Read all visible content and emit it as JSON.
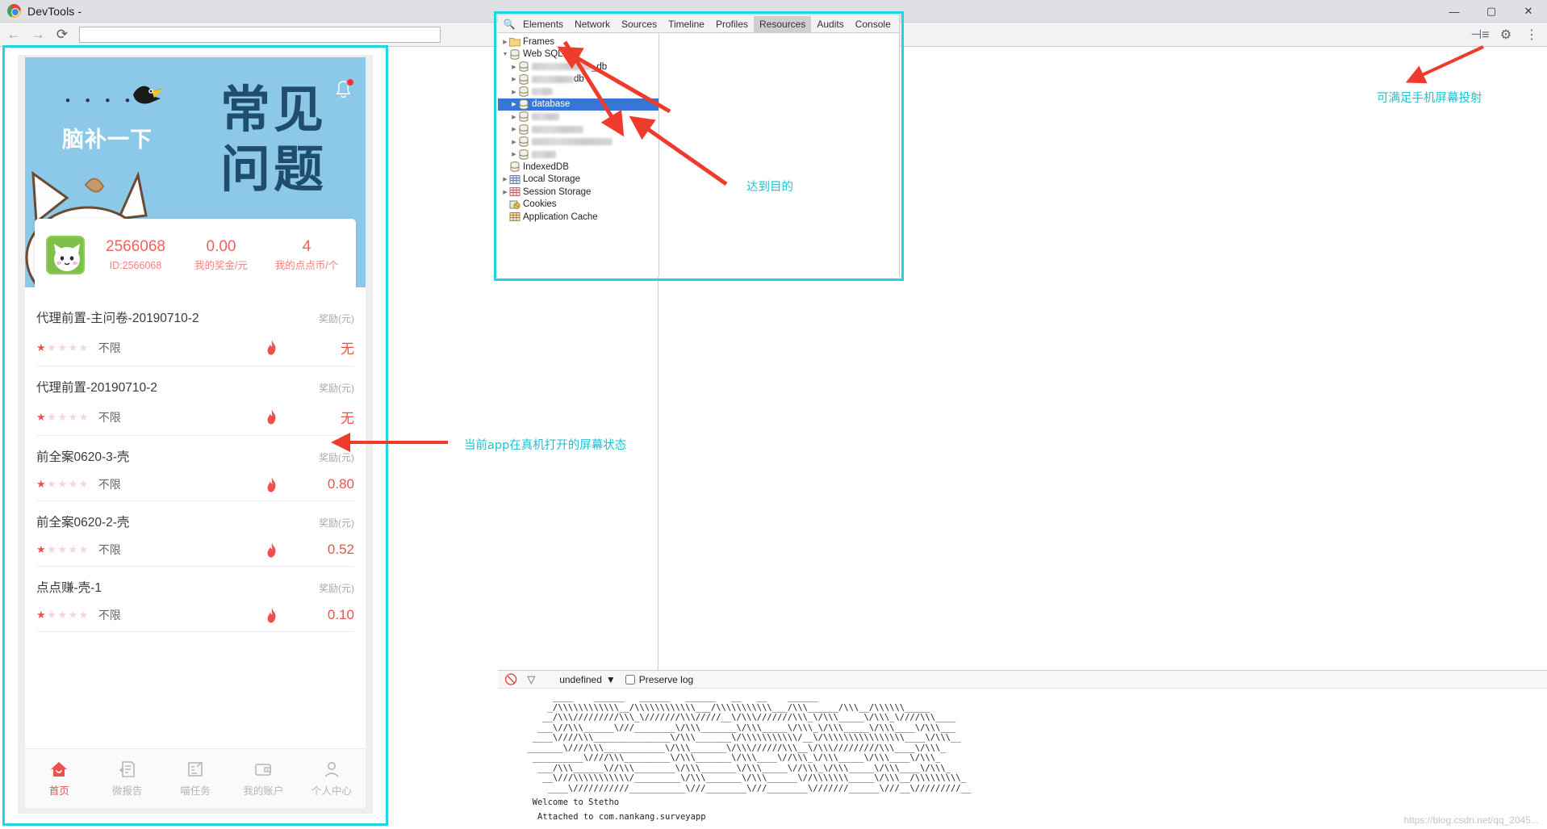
{
  "window": {
    "title": "DevTools -",
    "controls": {
      "minimize": "—",
      "maximize": "▢",
      "close": "✕"
    }
  },
  "navbar": {
    "back": "←",
    "forward": "→",
    "reload": "⟳",
    "url_value": "",
    "url_placeholder": "",
    "right_icons": [
      "dock-icon",
      "gear-icon",
      "more-icon"
    ]
  },
  "devtools": {
    "search_icon": "search-icon",
    "tabs": [
      {
        "label": "Elements",
        "selected": false
      },
      {
        "label": "Network",
        "selected": false
      },
      {
        "label": "Sources",
        "selected": false
      },
      {
        "label": "Timeline",
        "selected": false
      },
      {
        "label": "Profiles",
        "selected": false
      },
      {
        "label": "Resources",
        "selected": true
      },
      {
        "label": "Audits",
        "selected": false
      },
      {
        "label": "Console",
        "selected": false
      }
    ],
    "tree": [
      {
        "label": "Frames",
        "icon": "folder-icon",
        "indent": 0,
        "twisty": "collapsed",
        "blurred": false,
        "selected": false
      },
      {
        "label": "Web SQL",
        "icon": "database-icon",
        "indent": 0,
        "twisty": "expanded",
        "blurred": false,
        "selected": false
      },
      {
        "label": "_db",
        "icon": "database-icon",
        "indent": 1,
        "twisty": "collapsed",
        "blurred": true,
        "blur_width": 74,
        "selected": false
      },
      {
        "label": "db",
        "icon": "database-icon",
        "indent": 1,
        "twisty": "collapsed",
        "blurred": true,
        "blur_width": 52,
        "selected": false
      },
      {
        "label": "",
        "icon": "database-icon",
        "indent": 1,
        "twisty": "collapsed",
        "blurred": true,
        "blur_width": 26,
        "selected": false
      },
      {
        "label": "database",
        "icon": "database-icon",
        "indent": 1,
        "twisty": "collapsed",
        "blurred": false,
        "selected": true
      },
      {
        "label": "",
        "icon": "database-icon",
        "indent": 1,
        "twisty": "collapsed",
        "blurred": true,
        "blur_width": 34,
        "selected": false
      },
      {
        "label": "",
        "icon": "database-icon",
        "indent": 1,
        "twisty": "collapsed",
        "blurred": true,
        "blur_width": 64,
        "selected": false
      },
      {
        "label": "",
        "icon": "database-icon",
        "indent": 1,
        "twisty": "collapsed",
        "blurred": true,
        "blur_width": 100,
        "selected": false
      },
      {
        "label": "",
        "icon": "database-icon",
        "indent": 1,
        "twisty": "collapsed",
        "blurred": true,
        "blur_width": 30,
        "selected": false
      },
      {
        "label": "IndexedDB",
        "icon": "database-icon",
        "indent": 0,
        "twisty": "none",
        "blurred": false,
        "selected": false
      },
      {
        "label": "Local Storage",
        "icon": "table-icon-blue",
        "indent": 0,
        "twisty": "collapsed",
        "blurred": false,
        "selected": false
      },
      {
        "label": "Session Storage",
        "icon": "table-icon-pink",
        "indent": 0,
        "twisty": "collapsed",
        "blurred": false,
        "selected": false
      },
      {
        "label": "Cookies",
        "icon": "cookies-icon",
        "indent": 0,
        "twisty": "none",
        "blurred": false,
        "selected": false
      },
      {
        "label": "Application Cache",
        "icon": "table-icon-orange",
        "indent": 0,
        "twisty": "none",
        "blurred": false,
        "selected": false
      }
    ]
  },
  "console": {
    "clear_icon": "clear-icon",
    "filter_icon": "filter-icon",
    "context_selected": "undefined",
    "context_caret": "▼",
    "preserve_log_label": "Preserve log",
    "preserve_log_checked": false,
    "ascii_art": "      ____    ______   ______   ______   __   __    ______\n     _/\\\\\\\\\\\\\\\\\\\\\\\\__/\\\\\\\\\\\\\\\\\\\\\\\\___/\\\\\\\\\\\\\\\\\\\\\\___/\\\\\\______/\\\\\\__/\\\\\\\\\\\\_____\n    __/\\\\\\/////////\\\\\\_\\///////\\\\\\/////__\\/\\\\\\///////\\\\\\_\\/\\\\\\_____\\/\\\\\\_\\////\\\\\\____\n   ___\\//\\\\\\______\\///________\\/\\\\\\_______\\/\\\\\\_____\\/\\\\\\_\\/\\\\\\_____\\/\\\\\\____\\/\\\\\\___\n  ____\\////\\\\\\_______________\\/\\\\\\_______\\/\\\\\\\\\\\\\\\\\\\\\\/__\\/\\\\\\\\\\\\\\\\\\\\\\\\\\\\\\\\____\\/\\\\\\__\n _______\\////\\\\\\____________\\/\\\\\\_______\\/\\\\\\//////\\\\\\__\\/\\\\\\/////////\\\\\\____\\/\\\\\\_\n  __________\\////\\\\\\_________\\/\\\\\\_______\\/\\\\\\____\\//\\\\\\_\\/\\\\\\_____\\/\\\\\\____\\/\\\\\\_\n   ___/\\\\\\______\\//\\\\\\________\\/\\\\\\_______\\/\\\\\\_____\\//\\\\\\_\\/\\\\\\_____\\/\\\\\\____\\/\\\\\\_\n    __\\///\\\\\\\\\\\\\\\\\\\\\\/_________\\/\\\\\\_______\\/\\\\\\______\\//\\\\\\\\\\\\\\_____\\/\\\\\\__/\\\\\\\\\\\\\\\\\\_\n     ____\\///////////___________\\///________\\///________\\///////______\\///__\\/////////__",
    "welcome_line": "  Welcome to Stetho",
    "attached_line": "   Attached to com.nankang.surveyapp"
  },
  "annotations": [
    {
      "id": "ann-mirror",
      "text": "可满足手机屏幕投射"
    },
    {
      "id": "ann-goal",
      "text": "达到目的"
    },
    {
      "id": "ann-app-state",
      "text": "当前app在真机打开的屏幕状态"
    }
  ],
  "app": {
    "banner": {
      "dots": "• • • • •",
      "subtitle": "脑补一下",
      "title_line1": "常见",
      "title_line2": "问题",
      "bell_icon": "bell-icon",
      "bell_badge": true,
      "bird_icon": "bird-icon",
      "cat_icon": "cat-mascot"
    },
    "stats": {
      "avatar": "user-avatar",
      "columns": [
        {
          "value": "2566068",
          "label": "ID:2566068"
        },
        {
          "value": "0.00",
          "label": "我的奖金/元"
        },
        {
          "value": "4",
          "label": "我的点点币/个"
        }
      ]
    },
    "tasks": [
      {
        "name": "代理前置-主问卷-20190710-2",
        "reward_label": "奖励(元)",
        "stars": 1,
        "limit": "不限",
        "flame": "flame-icon",
        "reward": "无"
      },
      {
        "name": "代理前置-20190710-2",
        "reward_label": "奖励(元)",
        "stars": 1,
        "limit": "不限",
        "flame": "flame-icon",
        "reward": "无"
      },
      {
        "name": "前全案0620-3-壳",
        "reward_label": "奖励(元)",
        "stars": 1,
        "limit": "不限",
        "flame": "flame-icon",
        "reward": "0.80"
      },
      {
        "name": "前全案0620-2-壳",
        "reward_label": "奖励(元)",
        "stars": 1,
        "limit": "不限",
        "flame": "flame-icon",
        "reward": "0.52"
      },
      {
        "name": "点点赚-壳-1",
        "reward_label": "奖励(元)",
        "stars": 1,
        "limit": "不限",
        "flame": "flame-icon",
        "reward": "0.10"
      }
    ],
    "tabbar": [
      {
        "label": "首页",
        "icon": "home-icon",
        "active": true
      },
      {
        "label": "微报告",
        "icon": "report-icon",
        "active": false
      },
      {
        "label": "喵任务",
        "icon": "task-icon",
        "active": false
      },
      {
        "label": "我的账户",
        "icon": "wallet-icon",
        "active": false
      },
      {
        "label": "个人中心",
        "icon": "person-icon",
        "active": false
      }
    ]
  },
  "watermark": "https://blog.csdn.net/qq_2045..."
}
